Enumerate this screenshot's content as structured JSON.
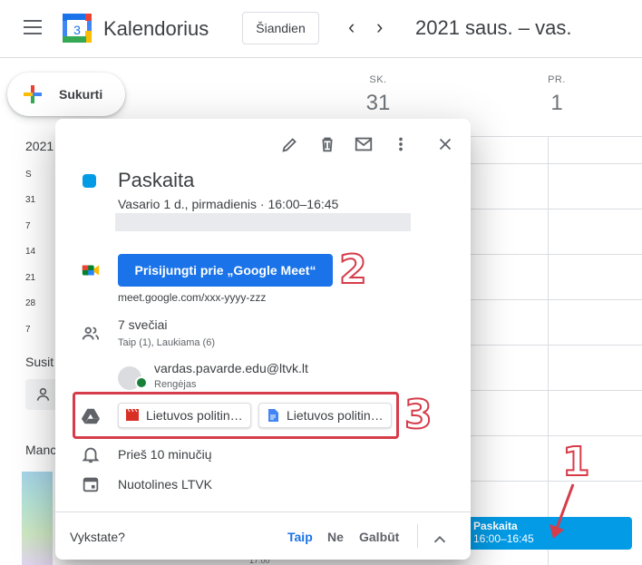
{
  "header": {
    "menu_icon": "hamburger-menu-icon",
    "app_name": "Kalendorius",
    "logo_day": "3",
    "today_label": "Šiandien",
    "date_range": "2021 saus. – vas."
  },
  "sidebar": {
    "create_label": "Sukurti",
    "mini_year": "2021",
    "mini_rows": [
      "S",
      "31",
      "7",
      "14",
      "21",
      "28",
      "7"
    ],
    "section_meet": "Susit",
    "section_my": "Manc"
  },
  "days": [
    {
      "name": "SK.",
      "num": "31"
    },
    {
      "name": "PR.",
      "num": "1"
    }
  ],
  "event_chip": {
    "title": "Paskaita",
    "time": "16:00–16:45"
  },
  "time_label": "17:00",
  "popup": {
    "title": "Paskaita",
    "datetime": "Vasario 1 d., pirmadienis  ·  16:00–16:45",
    "meet_button": "Prisijungti prie „Google Meet“",
    "meet_link": "meet.google.com/xxx-yyyy-zzz",
    "guests_count": "7 svečiai",
    "guests_detail": "Taip (1), Laukiama (6)",
    "organizer_email": "vardas.pavarde.edu@ltvk.lt",
    "organizer_role": "Rengėjas",
    "attachments": [
      {
        "label": "Lietuvos politin…",
        "icon": "video-file-icon"
      },
      {
        "label": "Lietuvos politin…",
        "icon": "document-file-icon"
      }
    ],
    "reminder": "Prieš 10 minučių",
    "calendar_name": "Nuotolines LTVK",
    "rsvp_question": "Vykstate?",
    "rsvp_yes": "Taip",
    "rsvp_no": "Ne",
    "rsvp_maybe": "Galbūt"
  },
  "annotations": {
    "n1": "1",
    "n2": "2",
    "n3": "3",
    "color": "#d63c4a"
  },
  "colors": {
    "event": "#039be5",
    "primary": "#1a73e8",
    "annotation": "#d63c4a"
  }
}
